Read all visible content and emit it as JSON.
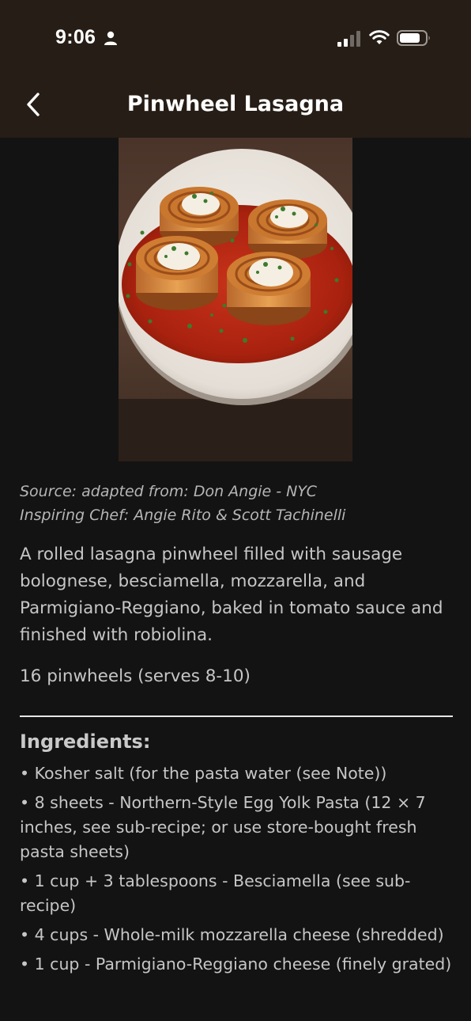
{
  "status_bar": {
    "time": "9:06"
  },
  "header": {
    "title": "Pinwheel Lasagna",
    "back_icon": "chevron-left-icon"
  },
  "recipe": {
    "source": "Source: adapted from: Don Angie - NYC",
    "chef": "Inspiring Chef:  Angie Rito & Scott Tachinelli",
    "description": "A rolled lasagna pinwheel filled with sausage bolognese, besciamella, mozzarella, and Parmigiano-Reggiano, baked in tomato sauce and finished with robiolina.",
    "yield": "16 pinwheels (serves 8-10)"
  },
  "ingredients": {
    "heading": "Ingredients:",
    "items": [
      "• Kosher salt (for the pasta water (see Note))",
      "• 8 sheets - Northern-Style Egg Yolk Pasta (12 × 7 inches, see sub-recipe; or use store-bought fresh pasta sheets)",
      "• 1 cup + 3 tablespoons - Besciamella (see sub-recipe)",
      "• 4 cups - Whole-milk mozzarella cheese (shredded)",
      "• 1 cup - Parmigiano-Reggiano cheese (finely grated)"
    ]
  },
  "colors": {
    "header_bg": "#261d16",
    "page_bg": "#131313",
    "text": "#c6c6c6",
    "title_text": "#ffffff"
  }
}
